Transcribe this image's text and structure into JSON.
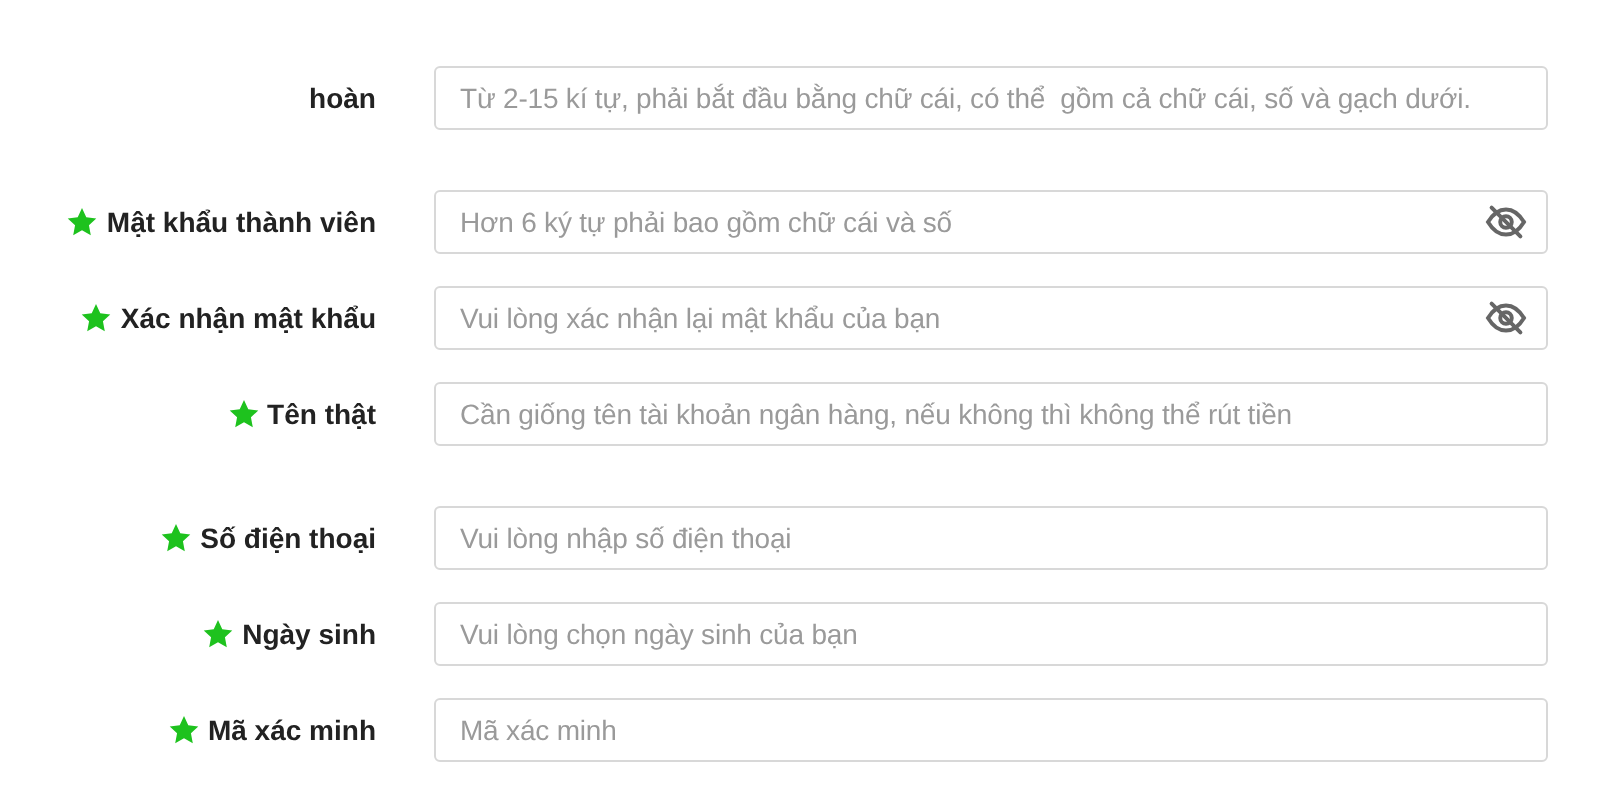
{
  "fields": [
    {
      "label": "hoàn",
      "required": false,
      "kind": "text",
      "placeholder": "Từ 2-15 kí tự, phải bắt đầu bằng chữ cái, có thể  gồm cả chữ cái, số và gạch dưới."
    },
    {
      "label": "Mật khẩu thành viên",
      "required": true,
      "kind": "password",
      "placeholder": "Hơn 6 ký tự phải bao gồm chữ cái và số"
    },
    {
      "label": "Xác nhận mật khẩu",
      "required": true,
      "kind": "password",
      "placeholder": "Vui lòng xác nhận lại mật khẩu của bạn"
    },
    {
      "label": "Tên thật",
      "required": true,
      "kind": "text",
      "placeholder": "Cần giống tên tài khoản ngân hàng, nếu không thì không thể rút tiền"
    },
    {
      "label": "Số điện thoại",
      "required": true,
      "kind": "text",
      "placeholder": "Vui lòng nhập số điện thoại"
    },
    {
      "label": "Ngày sinh",
      "required": true,
      "kind": "text",
      "placeholder": "Vui lòng chọn ngày sinh của bạn"
    },
    {
      "label": "Mã xác minh",
      "required": true,
      "kind": "text",
      "placeholder": "Mã xác minh"
    }
  ]
}
